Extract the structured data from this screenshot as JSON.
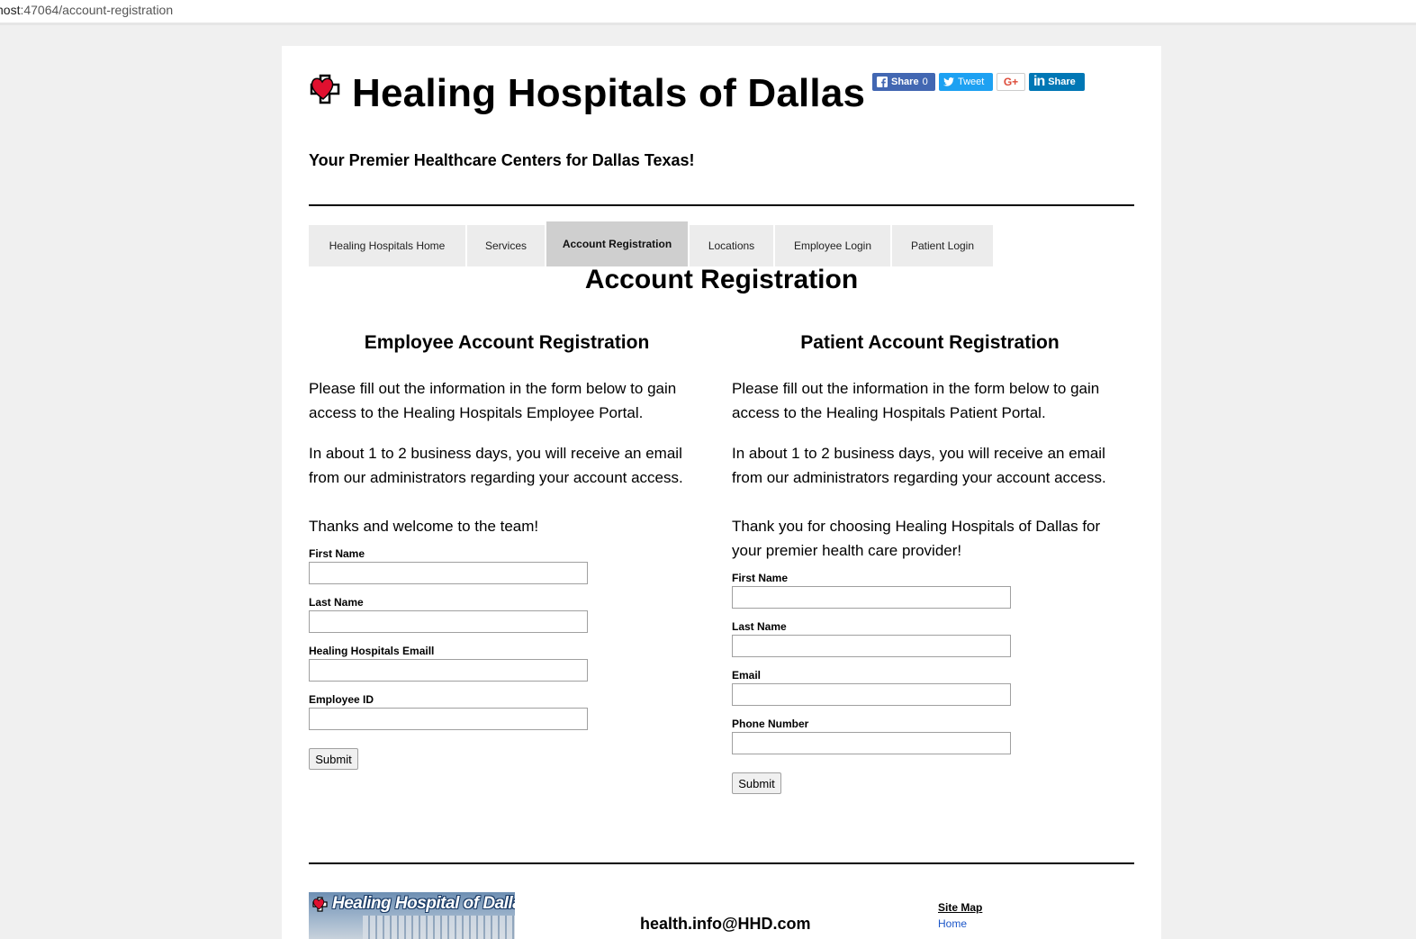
{
  "browser": {
    "url_host": "host",
    "url_path": ":47064/account-registration"
  },
  "header": {
    "site_title": "Healing Hospitals of Dallas",
    "tagline": "Your Premier Healthcare Centers for Dallas Texas!"
  },
  "social": {
    "facebook_label": "Share",
    "facebook_count": "0",
    "twitter_label": "Tweet",
    "googleplus_label": "G+",
    "linkedin_label": "Share"
  },
  "nav": {
    "items": [
      {
        "label": "Healing Hospitals Home"
      },
      {
        "label": "Services"
      },
      {
        "label": "Account Registration"
      },
      {
        "label": "Locations"
      },
      {
        "label": "Employee Login"
      },
      {
        "label": "Patient Login"
      }
    ]
  },
  "main": {
    "title": "Account Registration"
  },
  "employee": {
    "heading": "Employee Account Registration",
    "para1": "Please fill out the information in the form below to gain access to the Healing Hospitals Employee Portal.",
    "para2": "In about 1 to 2 business days, you will receive an email from our administrators regarding your account access.",
    "para3": "Thanks and welcome to the team!",
    "fields": [
      {
        "label": "First Name",
        "value": ""
      },
      {
        "label": "Last Name",
        "value": ""
      },
      {
        "label": "Healing Hospitals Emaill",
        "value": ""
      },
      {
        "label": "Employee ID",
        "value": ""
      }
    ],
    "submit_label": "Submit"
  },
  "patient": {
    "heading": "Patient Account Registration",
    "para1": "Please fill out the information in the form below to gain access to the Healing Hospitals Patient Portal.",
    "para2": "In about 1 to 2 business days, you will receive an email from our administrators regarding your account access.",
    "para3": "Thank you for choosing Healing Hospitals of Dallas for your premier health care provider!",
    "fields": [
      {
        "label": "First Name",
        "value": ""
      },
      {
        "label": "Last Name",
        "value": ""
      },
      {
        "label": "Email",
        "value": ""
      },
      {
        "label": "Phone Number",
        "value": ""
      }
    ],
    "submit_label": "Submit"
  },
  "footer": {
    "banner_text": "Healing Hospital of Dallas",
    "email": "health.info@HHD.com",
    "sitemap_title": "Site Map",
    "sitemap_links": [
      {
        "label": "Home"
      }
    ]
  },
  "colors": {
    "brand_red": "#e0102f",
    "nav_bg": "#ececec",
    "nav_active_bg": "#cfcfcf",
    "link_blue": "#1a55c8"
  }
}
